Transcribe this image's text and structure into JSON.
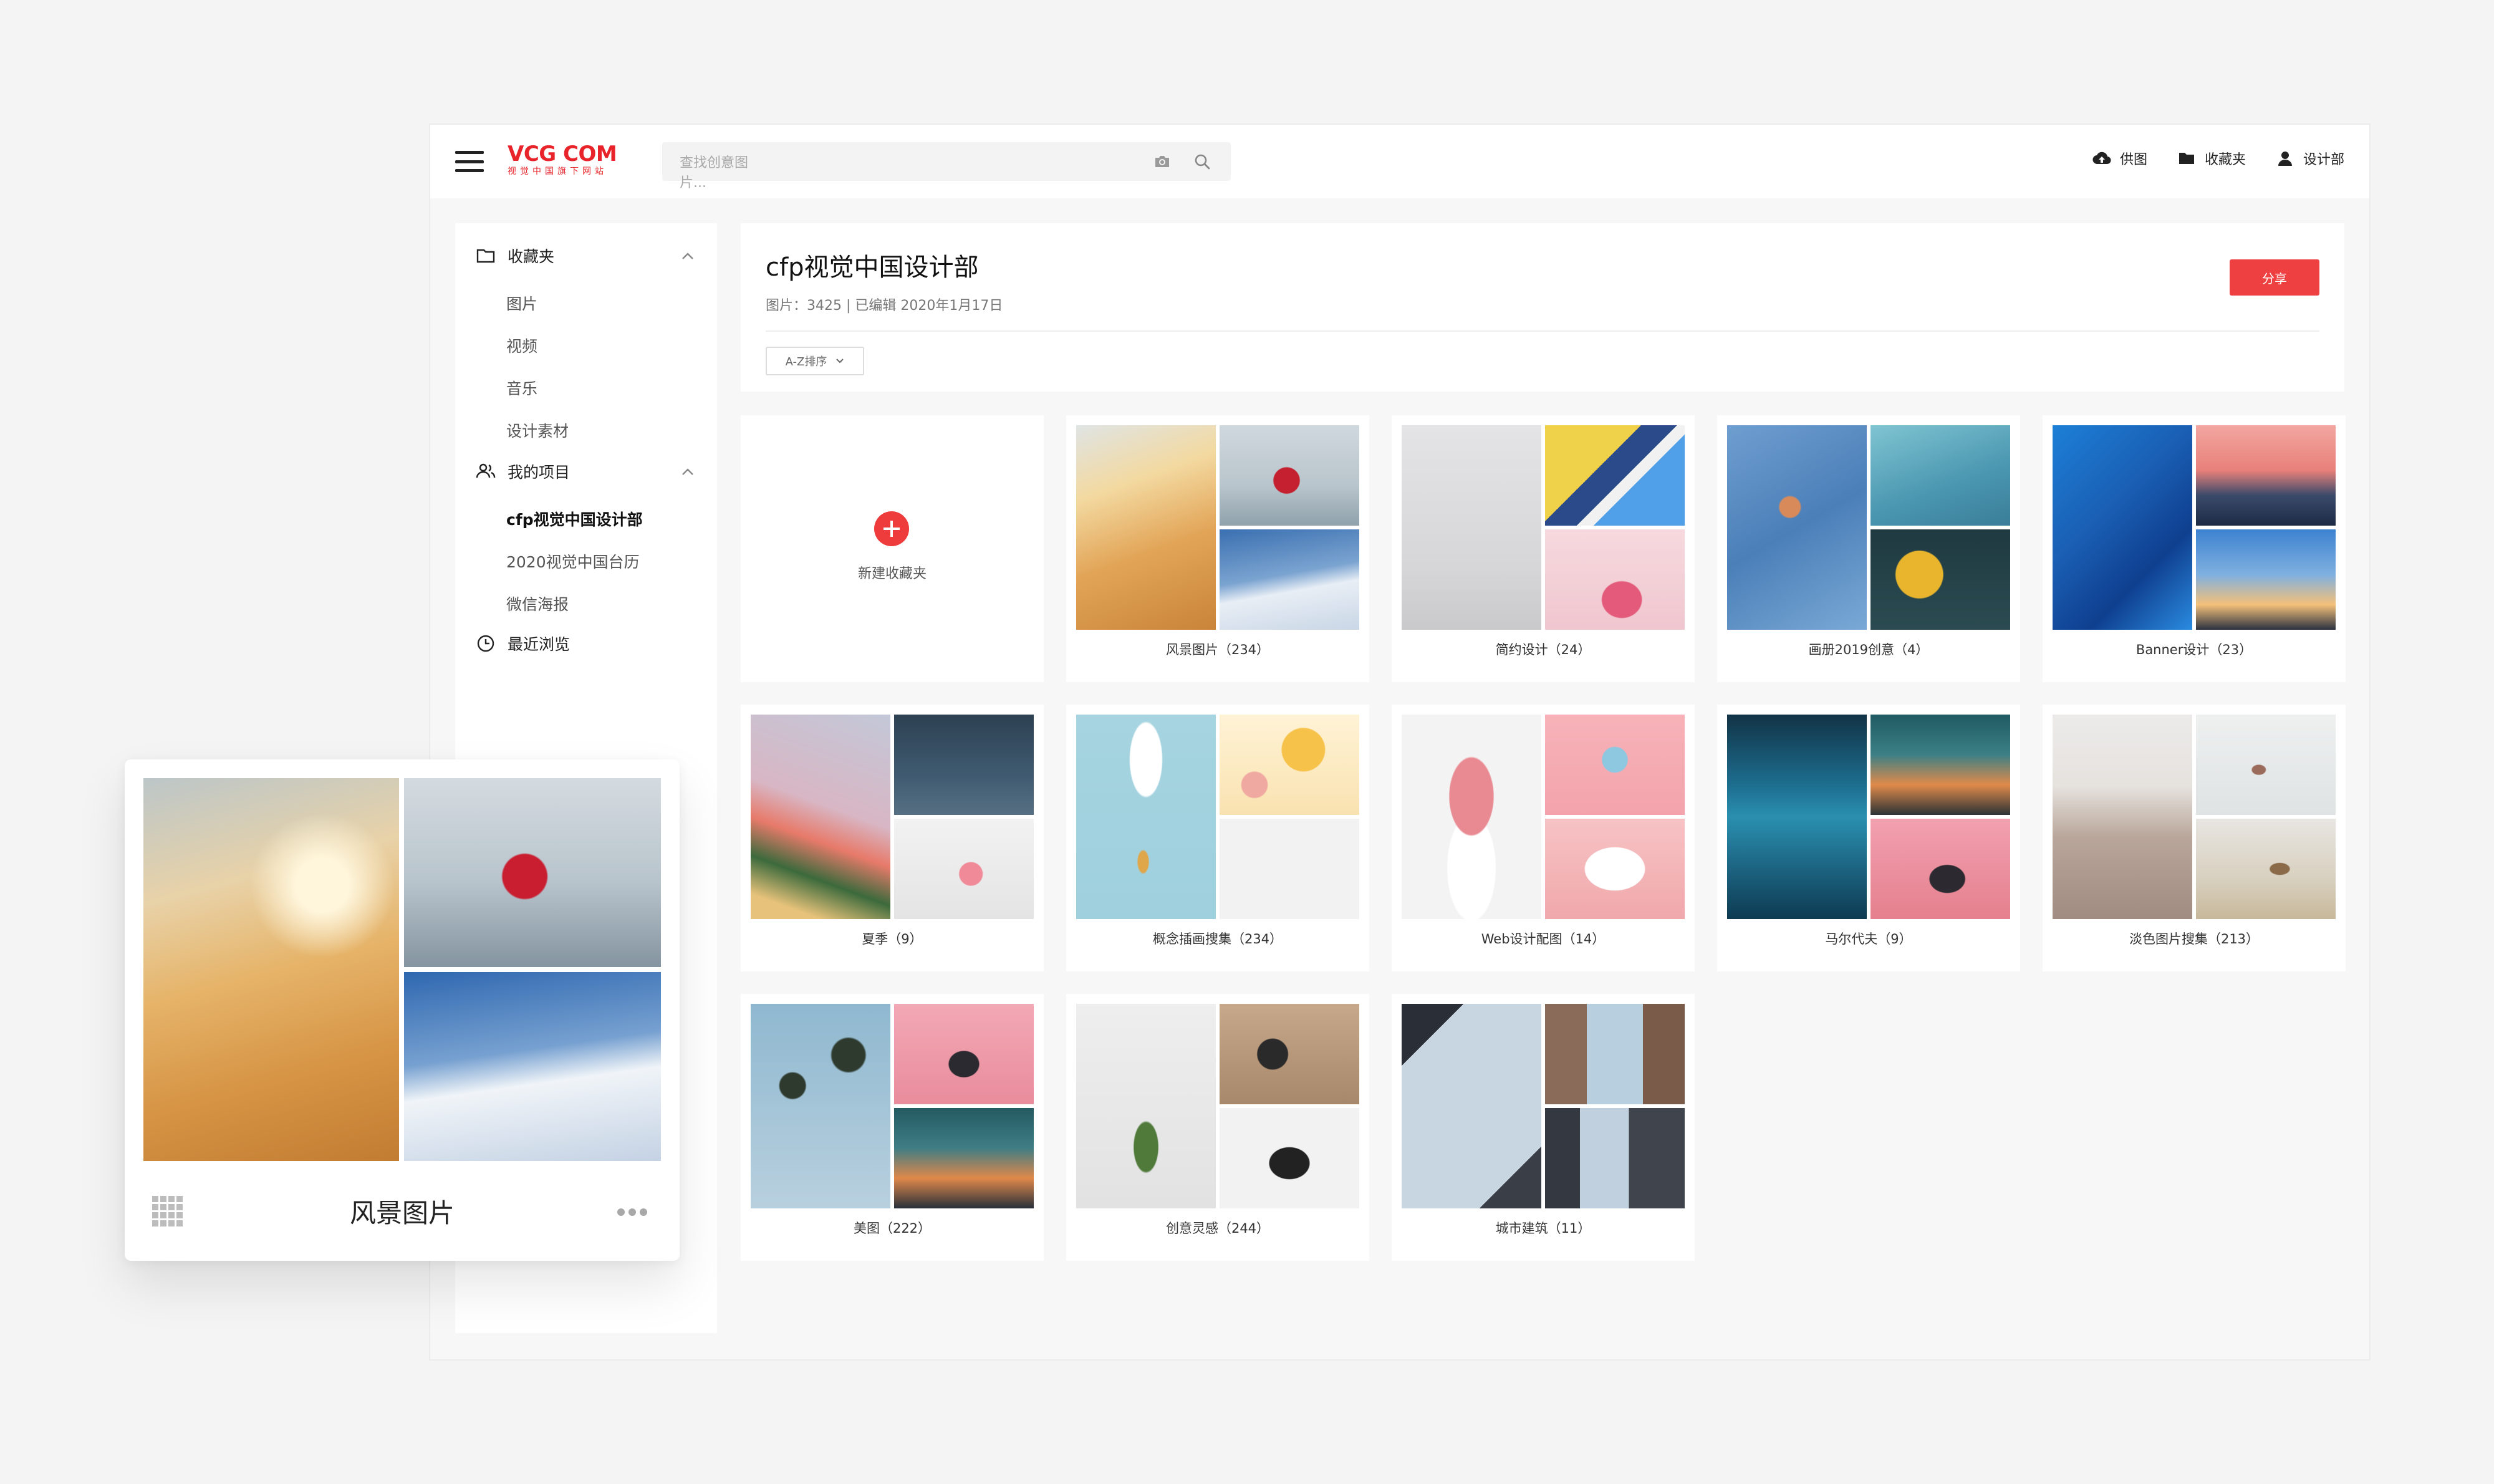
{
  "header": {
    "logo_main": "VCG COM",
    "logo_sub": "视觉中国旗下网站",
    "search_placeholder": "查找创意图片...",
    "actions": [
      "供图",
      "收藏夹",
      "设计部"
    ]
  },
  "sidebar": {
    "groups": [
      {
        "label": "收藏夹",
        "icon": "folder-icon",
        "items": [
          "图片",
          "视频",
          "音乐",
          "设计素材"
        ]
      },
      {
        "label": "我的项目",
        "icon": "users-icon",
        "items": [
          "cfp视觉中国设计部",
          "2020视觉中国台历",
          "微信海报"
        ]
      },
      {
        "label": "最近浏览",
        "icon": "clock-icon",
        "items": []
      }
    ],
    "active_item": "cfp视觉中国设计部"
  },
  "panel": {
    "title": "cfp视觉中国设计部",
    "meta": "图片：3425  |  已编辑 2020年1月17日",
    "sort_label": "A-Z排序",
    "share_label": "分享"
  },
  "new_collection_label": "新建收藏夹",
  "collections": [
    {
      "label": "风景图片（234）"
    },
    {
      "label": "简约设计（24）"
    },
    {
      "label": "画册2019创意（4）"
    },
    {
      "label": "Banner设计（23）"
    },
    {
      "label": "夏季（9）"
    },
    {
      "label": "概念插画搜集（234）"
    },
    {
      "label": "Web设计配图（14）"
    },
    {
      "label": "马尔代夫（9）"
    },
    {
      "label": "淡色图片搜集（213）"
    },
    {
      "label": "美图（222）"
    },
    {
      "label": "创意灵感（244）"
    },
    {
      "label": "城市建筑（11）"
    }
  ],
  "floating_card": {
    "title": "风景图片"
  },
  "colors": {
    "brand": "#e8232a",
    "accent": "#ee4040"
  }
}
